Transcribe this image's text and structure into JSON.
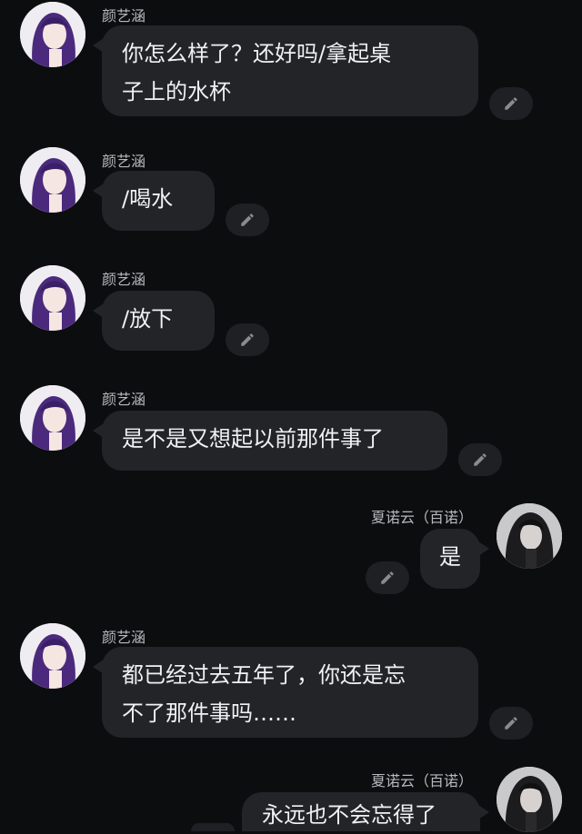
{
  "messages": [
    {
      "side": "left",
      "name": "颜艺涵",
      "lines": [
        "你怎么样了？还好吗/拿起桌",
        "子上的水杯"
      ],
      "edit_icon": "pencil-icon"
    },
    {
      "side": "left",
      "name": "颜艺涵",
      "lines": [
        "/喝水"
      ],
      "edit_icon": "pencil-icon"
    },
    {
      "side": "left",
      "name": "颜艺涵",
      "lines": [
        "/放下"
      ],
      "edit_icon": "pencil-icon"
    },
    {
      "side": "left",
      "name": "颜艺涵",
      "lines": [
        "是不是又想起以前那件事了"
      ],
      "edit_icon": "pencil-icon"
    },
    {
      "side": "right",
      "name": "夏诺云（百诺）",
      "lines": [
        "是"
      ],
      "edit_icon": "pencil-icon"
    },
    {
      "side": "left",
      "name": "颜艺涵",
      "lines": [
        "都已经过去五年了，你还是忘",
        "不了那件事吗……"
      ],
      "edit_icon": "pencil-icon"
    },
    {
      "side": "right",
      "name": "夏诺云（百诺）",
      "lines": [
        "永远也不会忘得了"
      ],
      "edit_icon": "pencil-icon"
    }
  ],
  "colors": {
    "background": "#0c0d0f",
    "bubble": "#232427",
    "name_text": "#b9b9bd"
  }
}
